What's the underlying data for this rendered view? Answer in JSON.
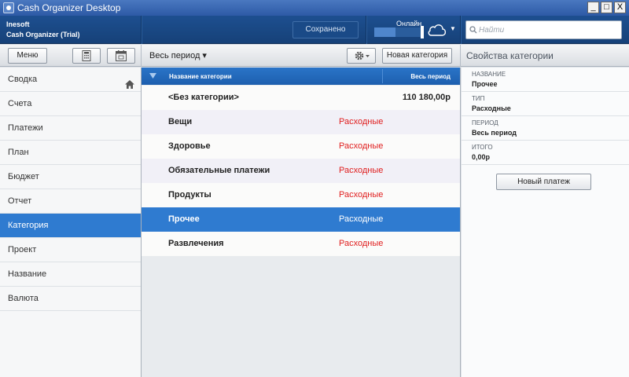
{
  "window": {
    "title": "Cash Organizer Desktop",
    "minimize": "_",
    "maximize": "□",
    "close": "X"
  },
  "header": {
    "company": "Inesoft",
    "product": "Cash Organizer (Trial)",
    "saved_label": "Сохранено",
    "online_label": "Онлайн",
    "online_level": 0.45,
    "search_placeholder": "Найти",
    "search_value": ""
  },
  "toolbar": {
    "menu_label": "Меню",
    "period_label": "Весь период ▾",
    "new_category_label": "Новая категория",
    "props_title": "Свойства категории"
  },
  "sidebar": {
    "items": [
      {
        "label": "Сводка",
        "active": false
      },
      {
        "label": "Счета",
        "active": false
      },
      {
        "label": "Платежи",
        "active": false
      },
      {
        "label": "План",
        "active": false
      },
      {
        "label": "Бюджет",
        "active": false
      },
      {
        "label": "Отчет",
        "active": false
      },
      {
        "label": "Категория",
        "active": true
      },
      {
        "label": "Проект",
        "active": false
      },
      {
        "label": "Название",
        "active": false
      },
      {
        "label": "Валюта",
        "active": false
      }
    ]
  },
  "list": {
    "columns": {
      "name": "Название категории",
      "total": "Весь период"
    },
    "rows": [
      {
        "name": "<Без категории>",
        "type": "",
        "amount": "110 180,00р"
      },
      {
        "name": "Вещи",
        "type": "Расходные",
        "amount": ""
      },
      {
        "name": "Здоровье",
        "type": "Расходные",
        "amount": ""
      },
      {
        "name": "Обязательные платежи",
        "type": "Расходные",
        "amount": ""
      },
      {
        "name": "Продукты",
        "type": "Расходные",
        "amount": ""
      },
      {
        "name": "Прочее",
        "type": "Расходные",
        "amount": "",
        "selected": true
      },
      {
        "name": "Развлечения",
        "type": "Расходные",
        "amount": ""
      }
    ]
  },
  "properties": {
    "fields": [
      {
        "label": "НАЗВАНИЕ",
        "value": "Прочее"
      },
      {
        "label": "ТИП",
        "value": "Расходные"
      },
      {
        "label": "ПЕРИОД",
        "value": "Весь период"
      },
      {
        "label": "ИТОГО",
        "value": "0,00р"
      }
    ],
    "new_payment_label": "Новый платеж"
  },
  "colors": {
    "accent": "#2f7bd0",
    "header": "#1d4f90",
    "expense_text": "#e02020"
  }
}
